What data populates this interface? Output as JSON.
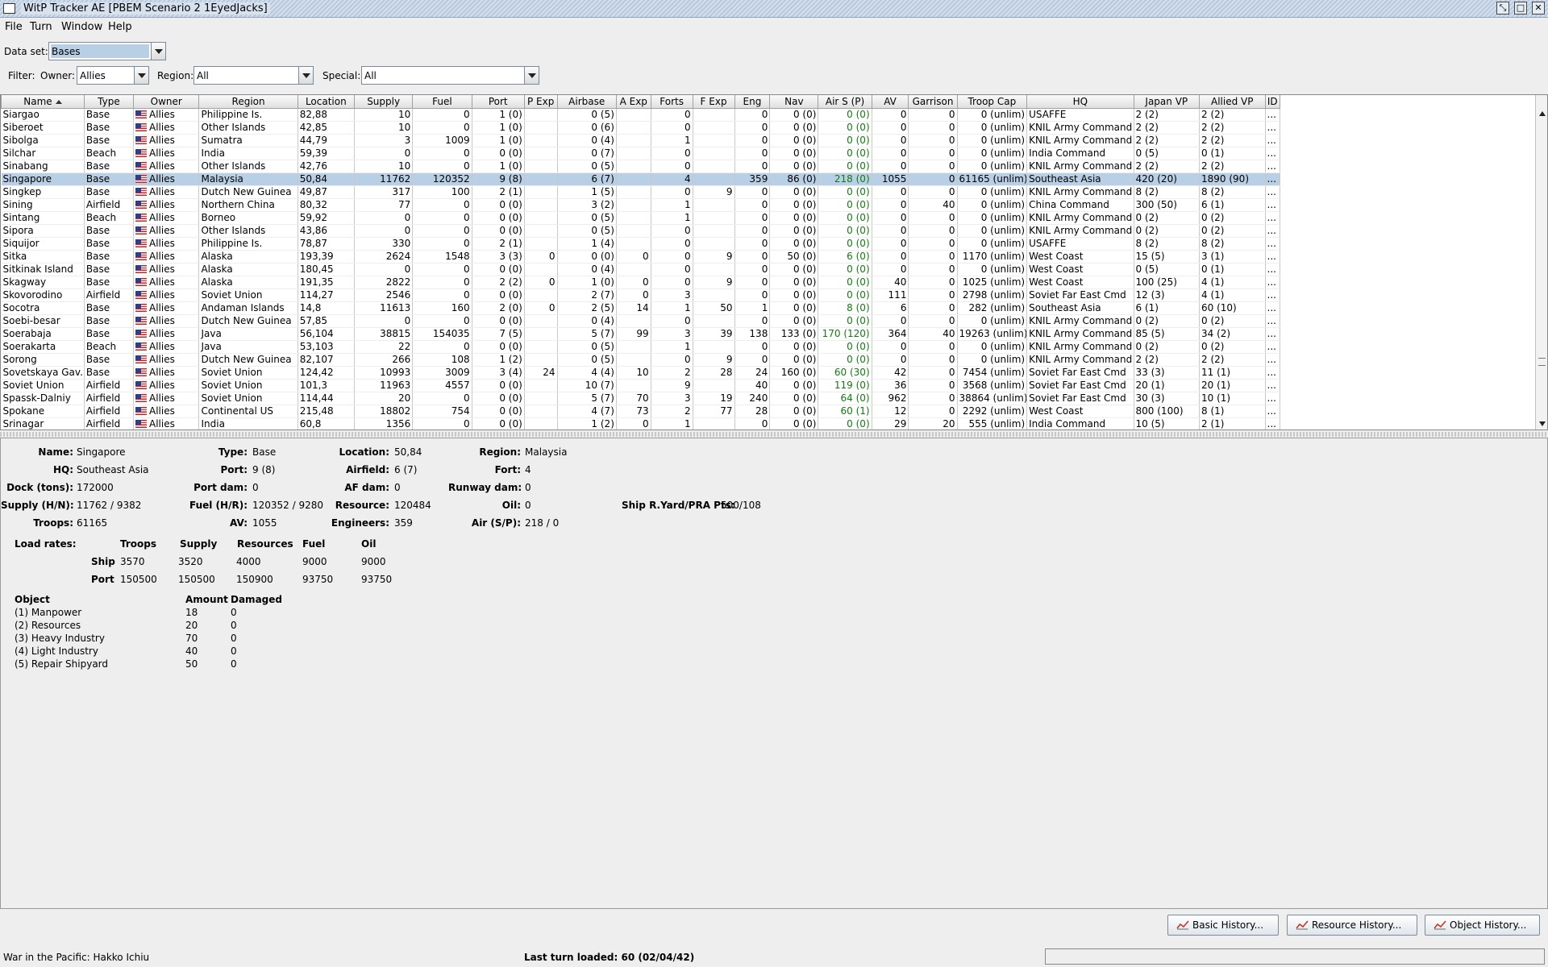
{
  "window": {
    "title": "WitP Tracker AE [PBEM Scenario 2 1EyedJacks]"
  },
  "menu": {
    "file": "File",
    "turn": "Turn",
    "window": "Window",
    "help": "Help"
  },
  "dataset": {
    "label": "Data set:",
    "value": "Bases"
  },
  "filter": {
    "label": "Filter:",
    "owner_label": "Owner:",
    "owner_value": "Allies",
    "region_label": "Region:",
    "region_value": "All",
    "special_label": "Special:",
    "special_value": "All"
  },
  "table": {
    "columns": [
      "Name",
      "Type",
      "Owner",
      "Region",
      "Location",
      "Supply",
      "Fuel",
      "Port",
      "P Exp",
      "Airbase",
      "A Exp",
      "Forts",
      "F Exp",
      "Eng",
      "Nav",
      "Air S (P)",
      "AV",
      "Garrison",
      "Troop Cap",
      "HQ",
      "Japan VP",
      "Allied VP",
      "ID"
    ],
    "sort_column": "Name",
    "selected_row": 5,
    "rows": [
      [
        "Siargao",
        "Base",
        "Allies",
        "Philippine Is.",
        "82,88",
        "10",
        "0",
        "1 (0)",
        "",
        "0 (5)",
        "",
        "0",
        "",
        "0",
        "0 (0)",
        "0 (0)",
        "0",
        "0",
        "0 (unlim)",
        "USAFFE",
        "2 (2)",
        "2 (2)",
        "..."
      ],
      [
        "Siberoet",
        "Base",
        "Allies",
        "Other Islands",
        "42,85",
        "10",
        "0",
        "1 (0)",
        "",
        "0 (6)",
        "",
        "0",
        "",
        "0",
        "0 (0)",
        "0 (0)",
        "0",
        "0",
        "0 (unlim)",
        "KNIL Army Command",
        "2 (2)",
        "2 (2)",
        "..."
      ],
      [
        "Sibolga",
        "Base",
        "Allies",
        "Sumatra",
        "44,79",
        "3",
        "1009",
        "1 (0)",
        "",
        "0 (4)",
        "",
        "1",
        "",
        "0",
        "0 (0)",
        "0 (0)",
        "0",
        "0",
        "0 (unlim)",
        "KNIL Army Command",
        "2 (2)",
        "2 (2)",
        "..."
      ],
      [
        "Silchar",
        "Beach",
        "Allies",
        "India",
        "59,39",
        "0",
        "0",
        "0 (0)",
        "",
        "0 (7)",
        "",
        "0",
        "",
        "0",
        "0 (0)",
        "0 (0)",
        "0",
        "0",
        "0 (unlim)",
        "India Command",
        "0 (5)",
        "0 (1)",
        "..."
      ],
      [
        "Sinabang",
        "Base",
        "Allies",
        "Other Islands",
        "42,76",
        "10",
        "0",
        "1 (0)",
        "",
        "0 (5)",
        "",
        "0",
        "",
        "0",
        "0 (0)",
        "0 (0)",
        "0",
        "0",
        "0 (unlim)",
        "KNIL Army Command",
        "2 (2)",
        "2 (2)",
        "..."
      ],
      [
        "Singapore",
        "Base",
        "Allies",
        "Malaysia",
        "50,84",
        "11762",
        "120352",
        "9 (8)",
        "",
        "6 (7)",
        "",
        "4",
        "",
        "359",
        "86 (0)",
        "218 (0)",
        "1055",
        "0",
        "61165 (unlim)",
        "Southeast Asia",
        "420 (20)",
        "1890 (90)",
        "..."
      ],
      [
        "Singkep",
        "Base",
        "Allies",
        "Dutch New Guinea",
        "49,87",
        "317",
        "100",
        "2 (1)",
        "",
        "1 (5)",
        "",
        "0",
        "9",
        "0",
        "0 (0)",
        "0 (0)",
        "0",
        "0",
        "0 (unlim)",
        "KNIL Army Command",
        "8 (2)",
        "8 (2)",
        "..."
      ],
      [
        "Sining",
        "Airfield",
        "Allies",
        "Northern China",
        "80,32",
        "77",
        "0",
        "0 (0)",
        "",
        "3 (2)",
        "",
        "1",
        "",
        "0",
        "0 (0)",
        "0 (0)",
        "0",
        "40",
        "0 (unlim)",
        "China Command",
        "300 (50)",
        "6 (1)",
        "..."
      ],
      [
        "Sintang",
        "Beach",
        "Allies",
        "Borneo",
        "59,92",
        "0",
        "0",
        "0 (0)",
        "",
        "0 (5)",
        "",
        "1",
        "",
        "0",
        "0 (0)",
        "0 (0)",
        "0",
        "0",
        "0 (unlim)",
        "KNIL Army Command",
        "0 (2)",
        "0 (2)",
        "..."
      ],
      [
        "Sipora",
        "Base",
        "Allies",
        "Other Islands",
        "43,86",
        "0",
        "0",
        "0 (0)",
        "",
        "0 (5)",
        "",
        "0",
        "",
        "0",
        "0 (0)",
        "0 (0)",
        "0",
        "0",
        "0 (unlim)",
        "KNIL Army Command",
        "0 (2)",
        "0 (2)",
        "..."
      ],
      [
        "Siquijor",
        "Base",
        "Allies",
        "Philippine Is.",
        "78,87",
        "330",
        "0",
        "2 (1)",
        "",
        "1 (4)",
        "",
        "0",
        "",
        "0",
        "0 (0)",
        "0 (0)",
        "0",
        "0",
        "0 (unlim)",
        "USAFFE",
        "8 (2)",
        "8 (2)",
        "..."
      ],
      [
        "Sitka",
        "Base",
        "Allies",
        "Alaska",
        "193,39",
        "2624",
        "1548",
        "3 (3)",
        "0",
        "0 (0)",
        "0",
        "0",
        "9",
        "0",
        "50 (0)",
        "6 (0)",
        "0",
        "0",
        "1170 (unlim)",
        "West Coast",
        "15 (5)",
        "3 (1)",
        "..."
      ],
      [
        "Sitkinak Island",
        "Base",
        "Allies",
        "Alaska",
        "180,45",
        "0",
        "0",
        "0 (0)",
        "",
        "0 (4)",
        "",
        "0",
        "",
        "0",
        "0 (0)",
        "0 (0)",
        "0",
        "0",
        "0 (unlim)",
        "West Coast",
        "0 (5)",
        "0 (1)",
        "..."
      ],
      [
        "Skagway",
        "Base",
        "Allies",
        "Alaska",
        "191,35",
        "2822",
        "0",
        "2 (2)",
        "0",
        "1 (0)",
        "0",
        "0",
        "9",
        "0",
        "0 (0)",
        "0 (0)",
        "40",
        "0",
        "1025 (unlim)",
        "West Coast",
        "100 (25)",
        "4 (1)",
        "..."
      ],
      [
        "Skovorodino",
        "Airfield",
        "Allies",
        "Soviet Union",
        "114,27",
        "2546",
        "0",
        "0 (0)",
        "",
        "2 (7)",
        "0",
        "3",
        "",
        "0",
        "0 (0)",
        "0 (0)",
        "111",
        "0",
        "2798 (unlim)",
        "Soviet Far East Cmd",
        "12 (3)",
        "4 (1)",
        "..."
      ],
      [
        "Socotra",
        "Base",
        "Allies",
        "Andaman Islands",
        "14,8",
        "11613",
        "160",
        "2 (0)",
        "0",
        "2 (5)",
        "14",
        "1",
        "50",
        "1",
        "0 (0)",
        "8 (0)",
        "6",
        "0",
        "282 (unlim)",
        "Southeast Asia",
        "6 (1)",
        "60 (10)",
        "..."
      ],
      [
        "Soebi-besar",
        "Base",
        "Allies",
        "Dutch New Guinea",
        "57,85",
        "0",
        "0",
        "0 (0)",
        "",
        "0 (4)",
        "",
        "0",
        "",
        "0",
        "0 (0)",
        "0 (0)",
        "0",
        "0",
        "0 (unlim)",
        "KNIL Army Command",
        "0 (2)",
        "0 (2)",
        "..."
      ],
      [
        "Soerabaja",
        "Base",
        "Allies",
        "Java",
        "56,104",
        "38815",
        "154035",
        "7 (5)",
        "",
        "5 (7)",
        "99",
        "3",
        "39",
        "138",
        "133 (0)",
        "170 (120)",
        "364",
        "40",
        "19263 (unlim)",
        "KNIL Army Command",
        "85 (5)",
        "34 (2)",
        "..."
      ],
      [
        "Soerakarta",
        "Beach",
        "Allies",
        "Java",
        "53,103",
        "22",
        "0",
        "0 (0)",
        "",
        "0 (5)",
        "",
        "1",
        "",
        "0",
        "0 (0)",
        "0 (0)",
        "0",
        "0",
        "0 (unlim)",
        "KNIL Army Command",
        "0 (2)",
        "0 (2)",
        "..."
      ],
      [
        "Sorong",
        "Base",
        "Allies",
        "Dutch New Guinea",
        "82,107",
        "266",
        "108",
        "1 (2)",
        "",
        "0 (5)",
        "",
        "0",
        "9",
        "0",
        "0 (0)",
        "0 (0)",
        "0",
        "0",
        "0 (unlim)",
        "KNIL Army Command",
        "2 (2)",
        "2 (2)",
        "..."
      ],
      [
        "Sovetskaya Gav...",
        "Base",
        "Allies",
        "Soviet Union",
        "124,42",
        "10993",
        "3009",
        "3 (4)",
        "24",
        "4 (4)",
        "10",
        "2",
        "28",
        "24",
        "160 (0)",
        "60 (30)",
        "42",
        "0",
        "7454 (unlim)",
        "Soviet Far East Cmd",
        "33 (3)",
        "11 (1)",
        "..."
      ],
      [
        "Soviet Union",
        "Airfield",
        "Allies",
        "Soviet Union",
        "101,3",
        "11963",
        "4557",
        "0 (0)",
        "",
        "10 (7)",
        "",
        "9",
        "",
        "40",
        "0 (0)",
        "119 (0)",
        "36",
        "0",
        "3568 (unlim)",
        "Soviet Far East Cmd",
        "20 (1)",
        "20 (1)",
        "..."
      ],
      [
        "Spassk-Dalniy",
        "Airfield",
        "Allies",
        "Soviet Union",
        "114,44",
        "20",
        "0",
        "0 (0)",
        "",
        "5 (7)",
        "70",
        "3",
        "19",
        "240",
        "0 (0)",
        "64 (0)",
        "962",
        "0",
        "38864 (unlim)",
        "Soviet Far East Cmd",
        "30 (3)",
        "10 (1)",
        "..."
      ],
      [
        "Spokane",
        "Airfield",
        "Allies",
        "Continental US",
        "215,48",
        "18802",
        "754",
        "0 (0)",
        "",
        "4 (7)",
        "73",
        "2",
        "77",
        "28",
        "0 (0)",
        "60 (1)",
        "12",
        "0",
        "2292 (unlim)",
        "West Coast",
        "800 (100)",
        "8 (1)",
        "..."
      ],
      [
        "Srinagar",
        "Airfield",
        "Allies",
        "India",
        "60,8",
        "1356",
        "0",
        "0 (0)",
        "",
        "1 (2)",
        "0",
        "1",
        "",
        "0",
        "0 (0)",
        "0 (0)",
        "29",
        "20",
        "555 (unlim)",
        "India Command",
        "10 (5)",
        "2 (1)",
        "..."
      ]
    ]
  },
  "detail": {
    "name_label": "Name:",
    "name": "Singapore",
    "hq_label": "HQ:",
    "hq": "Southeast Asia",
    "dock_label": "Dock (tons):",
    "dock": "172000",
    "supply_label": "Supply (H/N):",
    "supply": "11762 / 9382",
    "troops_label": "Troops:",
    "troops": "61165",
    "type_label": "Type:",
    "type": "Base",
    "port_label": "Port:",
    "port": "9 (8)",
    "portdam_label": "Port dam:",
    "portdam": "0",
    "fuel_label": "Fuel (H/R):",
    "fuel": "120352 / 9280",
    "av_label": "AV:",
    "av": "1055",
    "location_label": "Location:",
    "location": "50,84",
    "airfield_label": "Airfield:",
    "airfield": "6 (7)",
    "afdam_label": "AF dam:",
    "afdam": "0",
    "resource_label": "Resource:",
    "resource": "120484",
    "engineers_label": "Engineers:",
    "engineers": "359",
    "region_label": "Region:",
    "region": "Malaysia",
    "fort_label": "Fort:",
    "fort": "4",
    "runwaydam_label": "Runway dam:",
    "runwaydam": "0",
    "oil_label": "Oil:",
    "oil": "0",
    "airsp_label": "Air (S/P):",
    "airsp": "218 / 0",
    "shipyard_label": "Ship R.Yard/PRA Pts:",
    "shipyard": "500/108"
  },
  "load_rates": {
    "label": "Load rates:",
    "headers": [
      "Troops",
      "Supply",
      "Resources",
      "Fuel",
      "Oil"
    ],
    "rows": [
      {
        "label": "Ship",
        "values": [
          "3570",
          "3520",
          "4000",
          "9000",
          "9000"
        ]
      },
      {
        "label": "Port",
        "values": [
          "150500",
          "150500",
          "150900",
          "93750",
          "93750"
        ]
      }
    ]
  },
  "objects": {
    "headers": [
      "Object",
      "Amount",
      "Damaged"
    ],
    "rows": [
      [
        "(1) Manpower",
        "18",
        "0"
      ],
      [
        "(2) Resources",
        "20",
        "0"
      ],
      [
        "(3) Heavy Industry",
        "70",
        "0"
      ],
      [
        "(4) Light Industry",
        "40",
        "0"
      ],
      [
        "(5) Repair Shipyard",
        "50",
        "0"
      ]
    ]
  },
  "buttons": {
    "basic_history": "Basic History...",
    "resource_history": "Resource History...",
    "object_history": "Object History..."
  },
  "status": {
    "left": "War in the Pacific: Hakko Ichiu",
    "center": "Last turn loaded: 60 (02/04/42)"
  },
  "colors": {
    "selection": "#b8cfe5",
    "green_value": "#127a12"
  }
}
